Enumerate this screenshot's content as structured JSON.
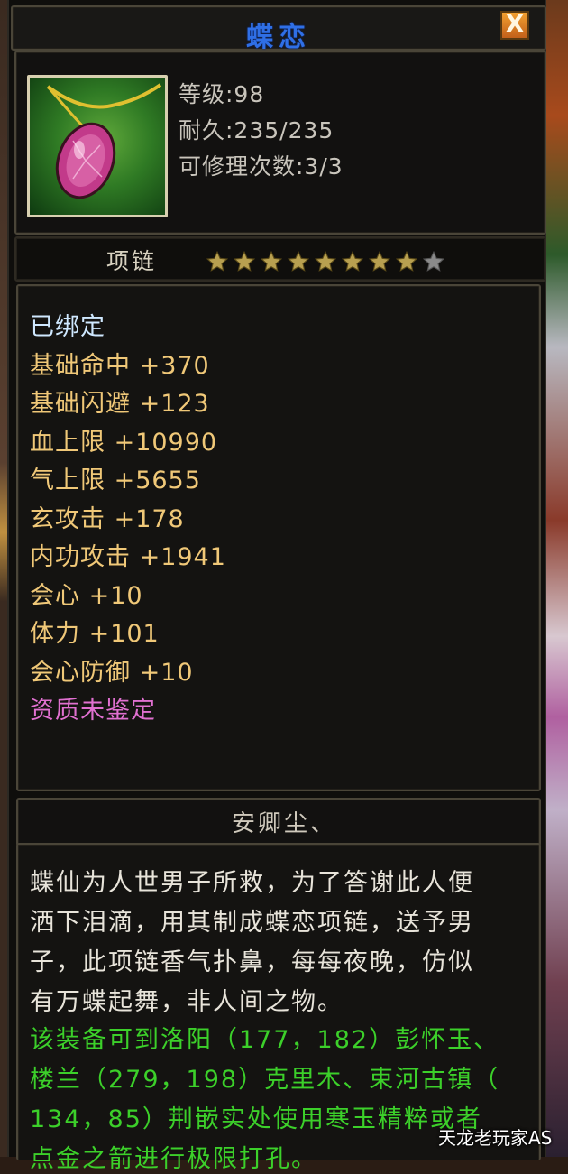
{
  "item": {
    "name": "蝶恋",
    "level_text": "等级:98",
    "durability_text": "耐久:235/235",
    "repair_text": "可修理次数:3/3",
    "type": "项链",
    "stars_filled": 8,
    "stars_total": 9
  },
  "close_label": "X",
  "stats": [
    {
      "text": "已绑定",
      "color": "#cfe8ff"
    },
    {
      "text": "基础命中  +370",
      "color": "#f0c878"
    },
    {
      "text": "基础闪避  +123",
      "color": "#f0c878"
    },
    {
      "text": "血上限  +10990",
      "color": "#f0c878"
    },
    {
      "text": "气上限  +5655",
      "color": "#f0c878"
    },
    {
      "text": "玄攻击  +178",
      "color": "#f0c878"
    },
    {
      "text": "内功攻击  +1941",
      "color": "#f0c878"
    },
    {
      "text": "会心  +10",
      "color": "#f0c878"
    },
    {
      "text": "体力  +101",
      "color": "#f0c878"
    },
    {
      "text": "会心防御  +10",
      "color": "#f0c878"
    },
    {
      "text": "资质未鉴定",
      "color": "#e070d0"
    }
  ],
  "owner": "安卿尘、",
  "description": [
    "蝶仙为人世男子所救，为了答谢此人便",
    "洒下泪滴，用其制成蝶恋项链，送予男",
    "子，此项链香气扑鼻，每每夜晚，仿似",
    "有万蝶起舞，非人间之物。"
  ],
  "green_text": [
    "该装备可到洛阳（177，182）彭怀玉、",
    "楼兰（279，198）克里木、束河古镇（",
    "134，85）荆嵌实处使用寒玉精粹或者",
    "点金之箭进行极限打孔。"
  ],
  "watermark": "天龙老玩家AS"
}
